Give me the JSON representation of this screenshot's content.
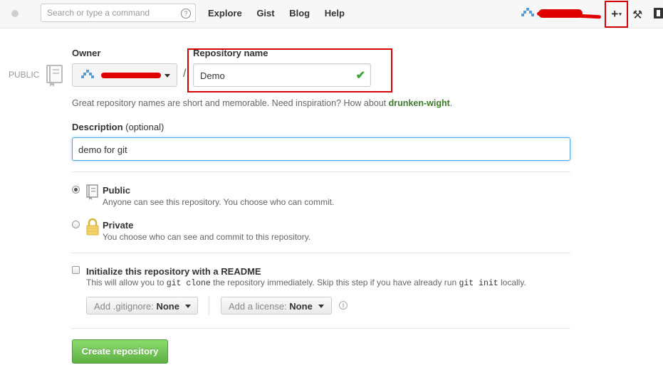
{
  "header": {
    "search_placeholder": "Search or type a command",
    "help_glyph": "?",
    "nav": [
      "Explore",
      "Gist",
      "Blog",
      "Help"
    ],
    "plus_label": "+",
    "plus_caret": "▾",
    "tools_glyph": "⚒"
  },
  "form": {
    "visibility_tag": "PUBLIC",
    "owner_label": "Owner",
    "repo_label": "Repository name",
    "slash": "/",
    "repo_value": "Demo",
    "check_glyph": "✔",
    "hint_prefix": "Great repository names are short and memorable. Need inspiration? How about ",
    "hint_suggestion": "drunken-wight",
    "hint_suffix": ".",
    "description_label": "Description",
    "description_optional": "(optional)",
    "description_value": "demo for git",
    "public_title": "Public",
    "public_desc": "Anyone can see this repository. You choose who can commit.",
    "private_title": "Private",
    "private_desc": "You choose who can see and commit to this repository.",
    "readme_title": "Initialize this repository with a README",
    "readme_desc_1": "This will allow you to ",
    "readme_code_1": "git clone",
    "readme_desc_2": " the repository immediately. Skip this step if you have already run ",
    "readme_code_2": "git init",
    "readme_desc_3": " locally.",
    "gitignore_label": "Add .gitignore:",
    "gitignore_value": "None",
    "license_label": "Add a license:",
    "license_value": "None",
    "info_glyph": "i",
    "create_button": "Create repository",
    "selected_visibility": "Public",
    "readme_checked": false
  },
  "colors": {
    "accent_green": "#60b044",
    "highlight_red": "#d60000",
    "suggestion_green": "#3c7b2a",
    "focus_blue": "#51a7e8"
  },
  "icons": [
    "search-icon",
    "help-icon",
    "plus-icon",
    "tools-icon",
    "sign-out-icon",
    "repo-book-icon",
    "check-icon",
    "lock-icon",
    "info-icon"
  ]
}
